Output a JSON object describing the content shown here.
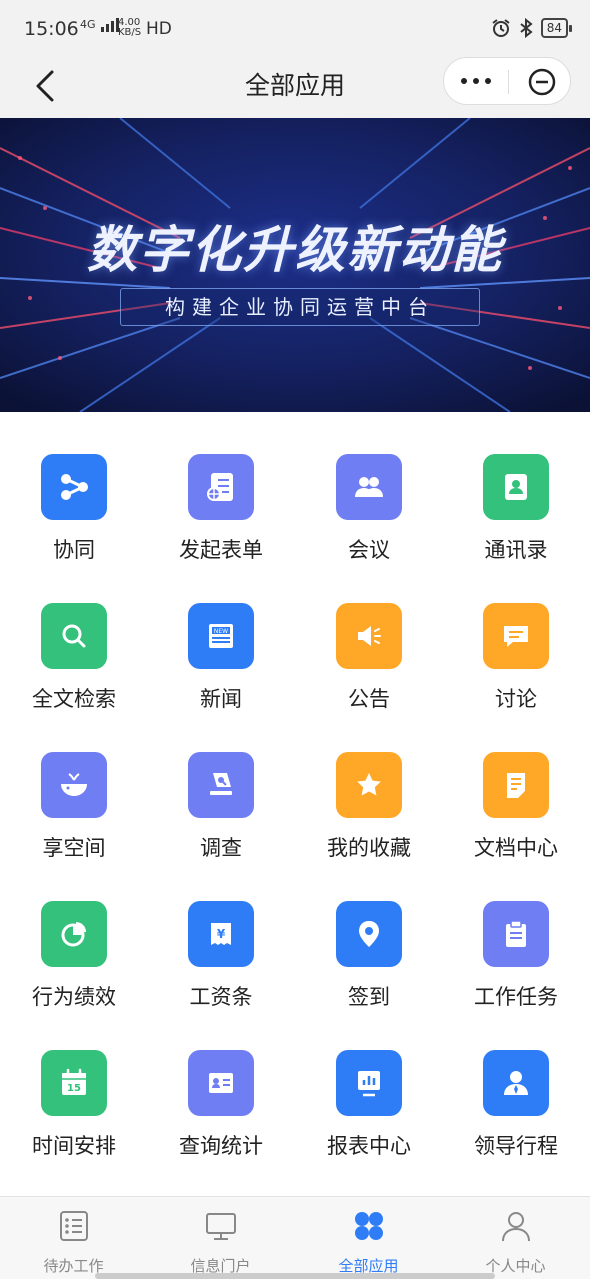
{
  "status_bar": {
    "time": "15:06",
    "network": "4G",
    "speed": "4.00 KB/S",
    "hd": "HD",
    "battery": "84"
  },
  "nav": {
    "title": "全部应用",
    "back_icon": "chevron-left-icon",
    "more_icon": "more-dots-icon",
    "close_icon": "circle-minus-icon"
  },
  "banner": {
    "title": "数字化升级新动能",
    "subtitle": "构建企业协同运营中台"
  },
  "apps": [
    {
      "label": "协同",
      "icon": "share-nodes-icon",
      "color": "#2f7df6"
    },
    {
      "label": "发起表单",
      "icon": "form-globe-icon",
      "color": "#6f7ef3"
    },
    {
      "label": "会议",
      "icon": "people-icon",
      "color": "#6f7ef3"
    },
    {
      "label": "通讯录",
      "icon": "contact-book-icon",
      "color": "#33c17c"
    },
    {
      "label": "全文检索",
      "icon": "search-icon",
      "color": "#33c17c"
    },
    {
      "label": "新闻",
      "icon": "news-icon",
      "color": "#2f7df6"
    },
    {
      "label": "公告",
      "icon": "megaphone-icon",
      "color": "#ffa727"
    },
    {
      "label": "讨论",
      "icon": "chat-bubble-icon",
      "color": "#ffa727"
    },
    {
      "label": "享空间",
      "icon": "whale-icon",
      "color": "#6f7ef3"
    },
    {
      "label": "调查",
      "icon": "survey-icon",
      "color": "#6f7ef3"
    },
    {
      "label": "我的收藏",
      "icon": "star-icon",
      "color": "#ffa727"
    },
    {
      "label": "文档中心",
      "icon": "document-icon",
      "color": "#ffa727"
    },
    {
      "label": "行为绩效",
      "icon": "pie-chart-icon",
      "color": "#33c17c"
    },
    {
      "label": "工资条",
      "icon": "yuan-receipt-icon",
      "color": "#2f7df6"
    },
    {
      "label": "签到",
      "icon": "location-pin-icon",
      "color": "#2f7df6"
    },
    {
      "label": "工作任务",
      "icon": "clipboard-icon",
      "color": "#6f7ef3"
    },
    {
      "label": "时间安排",
      "icon": "calendar-icon",
      "color": "#33c17c"
    },
    {
      "label": "查询统计",
      "icon": "id-card-icon",
      "color": "#6f7ef3"
    },
    {
      "label": "报表中心",
      "icon": "bar-chart-icon",
      "color": "#2f7df6"
    },
    {
      "label": "领导行程",
      "icon": "user-icon",
      "color": "#2f7df6"
    }
  ],
  "calendar_day": "15",
  "news_badge": "NEW",
  "salary_symbol": "¥",
  "tabs": [
    {
      "label": "待办工作",
      "icon": "todo-list-icon"
    },
    {
      "label": "信息门户",
      "icon": "monitor-icon"
    },
    {
      "label": "全部应用",
      "icon": "apps-grid-icon",
      "active": true
    },
    {
      "label": "个人中心",
      "icon": "person-icon"
    }
  ]
}
